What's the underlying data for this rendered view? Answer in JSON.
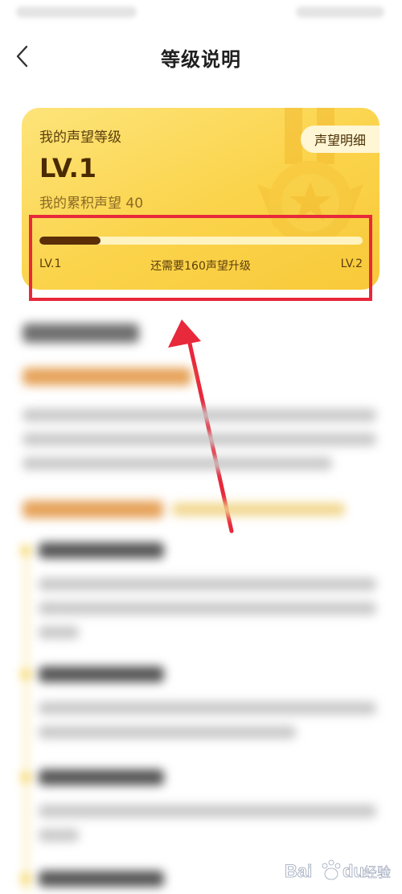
{
  "header": {
    "title": "等级说明",
    "back_icon": "chevron-left-icon"
  },
  "level_card": {
    "label": "我的声望等级",
    "level": "LV.1",
    "prestige_total": "我的累积声望 40",
    "detail_button": "声望明细",
    "progress": {
      "fraction": 0.19,
      "start_level": "LV.1",
      "end_level": "LV.2",
      "hint": "还需要160声望升级"
    }
  },
  "colors": {
    "card": "#fbd34a",
    "progress_fill": "#5b2e08",
    "progress_track": "#fff3c0",
    "annotation": "#e8283b"
  },
  "watermark": {
    "text": "经验"
  }
}
